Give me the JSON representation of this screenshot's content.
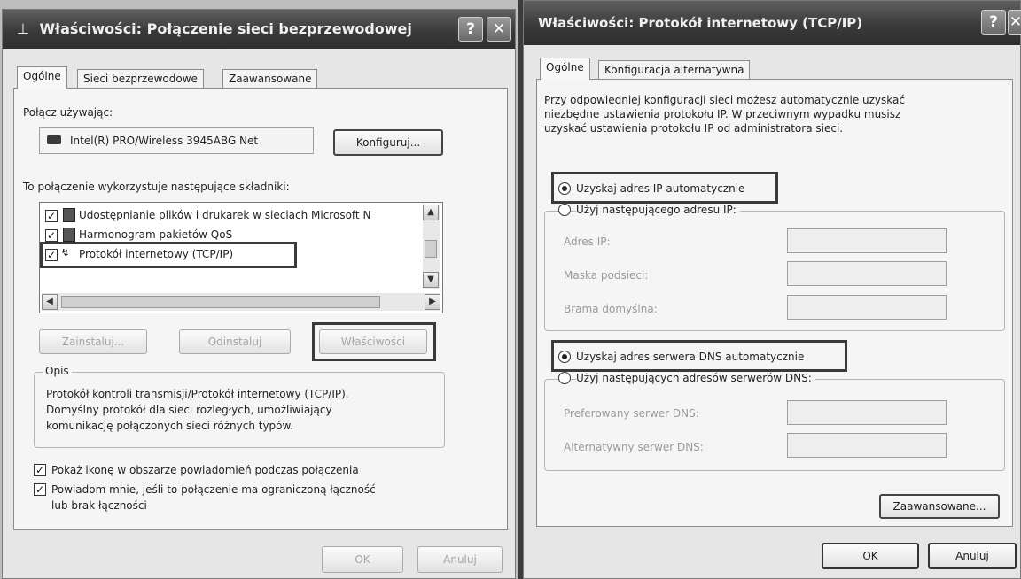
{
  "left_window": {
    "title": "Właściwości: Połączenie sieci bezprzewodowej",
    "help_glyph": "?",
    "close_glyph": "✕",
    "tabs": [
      "Ogólne",
      "Sieci bezprzewodowe",
      "Zaawansowane"
    ],
    "connect_using_label": "Połącz używając:",
    "adapter_name": "Intel(R) PRO/Wireless 3945ABG Net",
    "configure_button": "Konfiguruj...",
    "components_label": "To połączenie wykorzystuje następujące składniki:",
    "components": [
      {
        "label": "Udostępnianie plików i drukarek w sieciach Microsoft N",
        "checked": true,
        "icon": "network-share-icon"
      },
      {
        "label": "Harmonogram pakietów QoS",
        "checked": true,
        "icon": "qos-scheduler-icon"
      },
      {
        "label": "Protokół internetowy (TCP/IP)",
        "checked": true,
        "icon": "protocol-icon"
      }
    ],
    "install_button": "Zainstaluj...",
    "uninstall_button": "Odinstaluj",
    "properties_button": "Właściwości",
    "description_group": "Opis",
    "description_lines": [
      "Protokół kontroli transmisji/Protokół internetowy (TCP/IP).",
      "Domyślny protokół dla sieci rozległych, umożliwiający",
      "komunikację połączonych sieci różnych typów."
    ],
    "show_icon_label": "Pokaż ikonę w obszarze powiadomień podczas połączenia",
    "notify_label_line1": "Powiadom mnie, jeśli to połączenie ma ograniczoną łączność",
    "notify_label_line2": "lub brak łączności",
    "ok_button": "OK",
    "cancel_button": "Anuluj"
  },
  "right_window": {
    "title": "Właściwości: Protokół internetowy (TCP/IP)",
    "help_glyph": "?",
    "close_glyph": "✕",
    "tabs": [
      "Ogólne",
      "Konfiguracja alternatywna"
    ],
    "intro_lines": [
      "Przy odpowiedniej konfiguracji sieci możesz automatycznie uzyskać",
      "niezbędne ustawienia protokołu IP. W przeciwnym wypadku musisz",
      "uzyskać ustawienia protokołu IP od administratora sieci."
    ],
    "auto_ip_label": "Uzyskaj adres IP automatycznie",
    "manual_ip_label": "Użyj następującego adresu IP:",
    "ip_address_label": "Adres IP:",
    "subnet_label": "Maska podsieci:",
    "gateway_label": "Brama domyślna:",
    "auto_dns_label": "Uzyskaj adres serwera DNS automatycznie",
    "manual_dns_label": "Użyj następujących adresów serwerów DNS:",
    "preferred_dns_label": "Preferowany serwer DNS:",
    "alternate_dns_label": "Alternatywny serwer DNS:",
    "advanced_button": "Zaawansowane...",
    "ok_button": "OK",
    "cancel_button": "Anuluj"
  },
  "scroll_glyphs": {
    "up": "▲",
    "down": "▼",
    "left": "◀",
    "right": "▶"
  },
  "check_glyph": "✓"
}
